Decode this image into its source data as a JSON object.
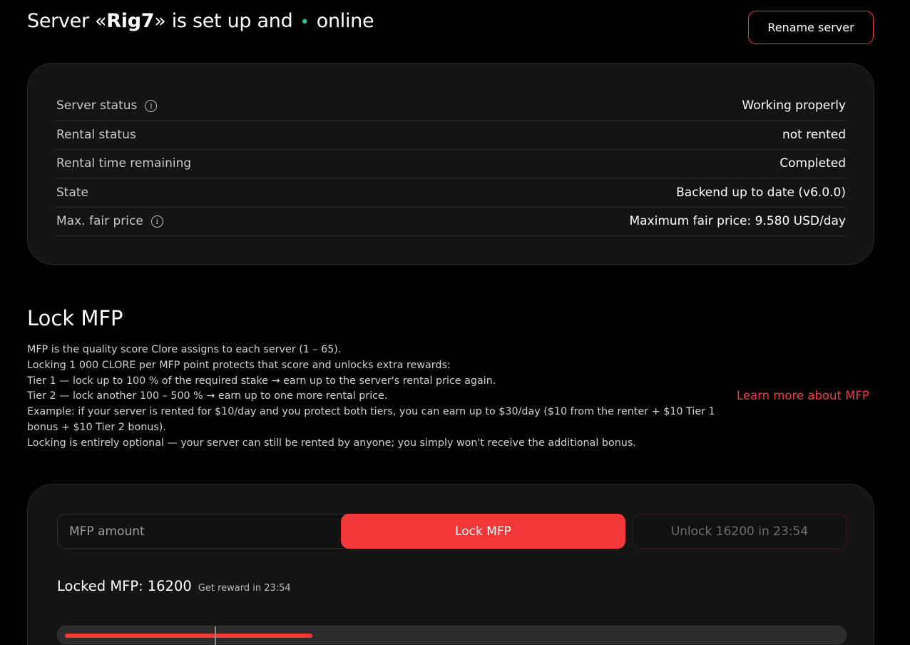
{
  "header": {
    "title_prefix": "Server «",
    "server_name": "Rig7",
    "title_middle": "» is set up and",
    "online_dot": "•",
    "online_text": "online",
    "rename_button": "Rename server",
    "online_color": "#2fc58a"
  },
  "status": {
    "rows": [
      {
        "label": "Server status",
        "value": "Working properly",
        "info": true
      },
      {
        "label": "Rental status",
        "value": "not rented",
        "info": false
      },
      {
        "label": "Rental time remaining",
        "value": "Completed",
        "info": false
      },
      {
        "label": "State",
        "value": "Backend up to date (v6.0.0)",
        "info": false
      },
      {
        "label": "Max. fair price",
        "value": "Maximum fair price: 9.580 USD/day",
        "info": true
      }
    ],
    "info_glyph": "i"
  },
  "lock_section": {
    "title": "Lock MFP",
    "description": [
      "MFP is the quality score Clore assigns to each server (1 – 65).",
      "Locking 1 000 CLORE per MFP point protects that score and unlocks extra rewards:",
      "Tier 1 — lock up to 100 % of the required stake → earn up to the server's rental price again.",
      "Tier 2 — lock another 100 – 500 % → earn up to one more rental price.",
      "Example: if your server is rented for $10/day and you protect both tiers, you can earn up to $30/day ($10 from the renter + $10 Tier 1 bonus + $10 Tier 2 bonus).",
      "Locking is entirely optional — your server can still be rented by anyone; you simply won't receive the additional bonus."
    ],
    "learn_more": "Learn more about MFP"
  },
  "lock_card": {
    "input_placeholder": "MFP amount",
    "lock_button": "Lock MFP",
    "unlock_button": "Unlock 16200 in 23:54",
    "locked_label": "Locked MFP:",
    "locked_value": "16200",
    "reward_text": "Get reward in 23:54",
    "progress_fraction": 0.32,
    "accent_color": "#f23838"
  }
}
